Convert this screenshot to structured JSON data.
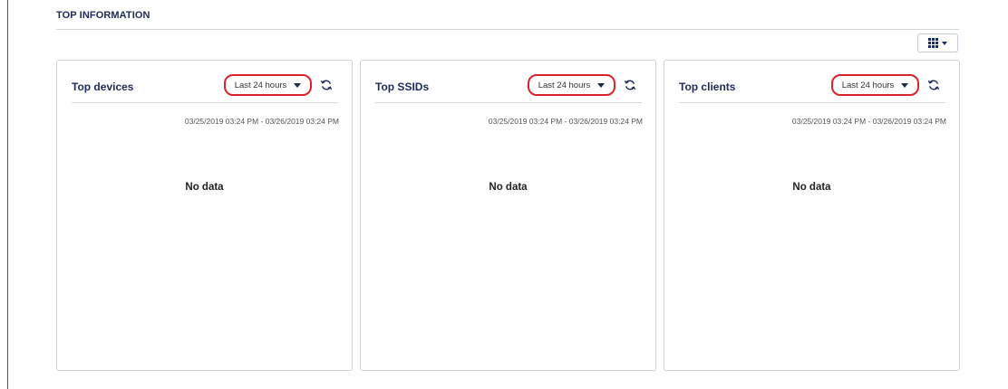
{
  "section": {
    "title": "TOP INFORMATION"
  },
  "panels": [
    {
      "title": "Top devices",
      "range": "Last 24 hours",
      "date_range": "03/25/2019 03:24 PM - 03/26/2019 03:24 PM",
      "empty_text": "No data"
    },
    {
      "title": "Top SSIDs",
      "range": "Last 24 hours",
      "date_range": "03/25/2019 03:24 PM - 03/26/2019 03:24 PM",
      "empty_text": "No data"
    },
    {
      "title": "Top clients",
      "range": "Last 24 hours",
      "date_range": "03/25/2019 03:24 PM - 03/26/2019 03:24 PM",
      "empty_text": "No data"
    }
  ],
  "icons": {
    "columns": "grid-icon",
    "refresh": "refresh-icon",
    "dropdown": "caret-down-icon"
  },
  "colors": {
    "accent": "#1f2a5c",
    "highlight": "#d9232e",
    "border": "#cfd3da"
  }
}
